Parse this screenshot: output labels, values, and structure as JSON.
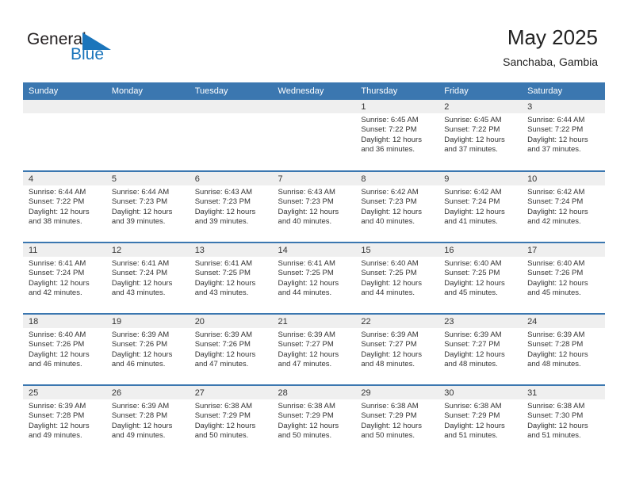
{
  "brand": {
    "name_part1": "General",
    "name_part2": "Blue",
    "flag_icon": "blue-flag-triangle-icon",
    "accent_color": "#1b75bb"
  },
  "header": {
    "title": "May 2025",
    "subtitle": "Sanchaba, Gambia"
  },
  "colors": {
    "header_row_bg": "#3b77b0",
    "daynum_band_bg": "#efefef",
    "row_divider": "#3b77b0",
    "text": "#333333"
  },
  "weekday_headers": [
    "Sunday",
    "Monday",
    "Tuesday",
    "Wednesday",
    "Thursday",
    "Friday",
    "Saturday"
  ],
  "labels": {
    "sunrise_prefix": "Sunrise:",
    "sunset_prefix": "Sunset:",
    "daylight_prefix": "Daylight:"
  },
  "weeks": [
    [
      {
        "day": "",
        "sunrise": "",
        "sunset": "",
        "daylight_line1": "",
        "daylight_line2": "",
        "empty": true
      },
      {
        "day": "",
        "sunrise": "",
        "sunset": "",
        "daylight_line1": "",
        "daylight_line2": "",
        "empty": true
      },
      {
        "day": "",
        "sunrise": "",
        "sunset": "",
        "daylight_line1": "",
        "daylight_line2": "",
        "empty": true
      },
      {
        "day": "",
        "sunrise": "",
        "sunset": "",
        "daylight_line1": "",
        "daylight_line2": "",
        "empty": true
      },
      {
        "day": "1",
        "sunrise": "Sunrise: 6:45 AM",
        "sunset": "Sunset: 7:22 PM",
        "daylight_line1": "Daylight: 12 hours",
        "daylight_line2": "and 36 minutes.",
        "empty": false
      },
      {
        "day": "2",
        "sunrise": "Sunrise: 6:45 AM",
        "sunset": "Sunset: 7:22 PM",
        "daylight_line1": "Daylight: 12 hours",
        "daylight_line2": "and 37 minutes.",
        "empty": false
      },
      {
        "day": "3",
        "sunrise": "Sunrise: 6:44 AM",
        "sunset": "Sunset: 7:22 PM",
        "daylight_line1": "Daylight: 12 hours",
        "daylight_line2": "and 37 minutes.",
        "empty": false
      }
    ],
    [
      {
        "day": "4",
        "sunrise": "Sunrise: 6:44 AM",
        "sunset": "Sunset: 7:22 PM",
        "daylight_line1": "Daylight: 12 hours",
        "daylight_line2": "and 38 minutes.",
        "empty": false
      },
      {
        "day": "5",
        "sunrise": "Sunrise: 6:44 AM",
        "sunset": "Sunset: 7:23 PM",
        "daylight_line1": "Daylight: 12 hours",
        "daylight_line2": "and 39 minutes.",
        "empty": false
      },
      {
        "day": "6",
        "sunrise": "Sunrise: 6:43 AM",
        "sunset": "Sunset: 7:23 PM",
        "daylight_line1": "Daylight: 12 hours",
        "daylight_line2": "and 39 minutes.",
        "empty": false
      },
      {
        "day": "7",
        "sunrise": "Sunrise: 6:43 AM",
        "sunset": "Sunset: 7:23 PM",
        "daylight_line1": "Daylight: 12 hours",
        "daylight_line2": "and 40 minutes.",
        "empty": false
      },
      {
        "day": "8",
        "sunrise": "Sunrise: 6:42 AM",
        "sunset": "Sunset: 7:23 PM",
        "daylight_line1": "Daylight: 12 hours",
        "daylight_line2": "and 40 minutes.",
        "empty": false
      },
      {
        "day": "9",
        "sunrise": "Sunrise: 6:42 AM",
        "sunset": "Sunset: 7:24 PM",
        "daylight_line1": "Daylight: 12 hours",
        "daylight_line2": "and 41 minutes.",
        "empty": false
      },
      {
        "day": "10",
        "sunrise": "Sunrise: 6:42 AM",
        "sunset": "Sunset: 7:24 PM",
        "daylight_line1": "Daylight: 12 hours",
        "daylight_line2": "and 42 minutes.",
        "empty": false
      }
    ],
    [
      {
        "day": "11",
        "sunrise": "Sunrise: 6:41 AM",
        "sunset": "Sunset: 7:24 PM",
        "daylight_line1": "Daylight: 12 hours",
        "daylight_line2": "and 42 minutes.",
        "empty": false
      },
      {
        "day": "12",
        "sunrise": "Sunrise: 6:41 AM",
        "sunset": "Sunset: 7:24 PM",
        "daylight_line1": "Daylight: 12 hours",
        "daylight_line2": "and 43 minutes.",
        "empty": false
      },
      {
        "day": "13",
        "sunrise": "Sunrise: 6:41 AM",
        "sunset": "Sunset: 7:25 PM",
        "daylight_line1": "Daylight: 12 hours",
        "daylight_line2": "and 43 minutes.",
        "empty": false
      },
      {
        "day": "14",
        "sunrise": "Sunrise: 6:41 AM",
        "sunset": "Sunset: 7:25 PM",
        "daylight_line1": "Daylight: 12 hours",
        "daylight_line2": "and 44 minutes.",
        "empty": false
      },
      {
        "day": "15",
        "sunrise": "Sunrise: 6:40 AM",
        "sunset": "Sunset: 7:25 PM",
        "daylight_line1": "Daylight: 12 hours",
        "daylight_line2": "and 44 minutes.",
        "empty": false
      },
      {
        "day": "16",
        "sunrise": "Sunrise: 6:40 AM",
        "sunset": "Sunset: 7:25 PM",
        "daylight_line1": "Daylight: 12 hours",
        "daylight_line2": "and 45 minutes.",
        "empty": false
      },
      {
        "day": "17",
        "sunrise": "Sunrise: 6:40 AM",
        "sunset": "Sunset: 7:26 PM",
        "daylight_line1": "Daylight: 12 hours",
        "daylight_line2": "and 45 minutes.",
        "empty": false
      }
    ],
    [
      {
        "day": "18",
        "sunrise": "Sunrise: 6:40 AM",
        "sunset": "Sunset: 7:26 PM",
        "daylight_line1": "Daylight: 12 hours",
        "daylight_line2": "and 46 minutes.",
        "empty": false
      },
      {
        "day": "19",
        "sunrise": "Sunrise: 6:39 AM",
        "sunset": "Sunset: 7:26 PM",
        "daylight_line1": "Daylight: 12 hours",
        "daylight_line2": "and 46 minutes.",
        "empty": false
      },
      {
        "day": "20",
        "sunrise": "Sunrise: 6:39 AM",
        "sunset": "Sunset: 7:26 PM",
        "daylight_line1": "Daylight: 12 hours",
        "daylight_line2": "and 47 minutes.",
        "empty": false
      },
      {
        "day": "21",
        "sunrise": "Sunrise: 6:39 AM",
        "sunset": "Sunset: 7:27 PM",
        "daylight_line1": "Daylight: 12 hours",
        "daylight_line2": "and 47 minutes.",
        "empty": false
      },
      {
        "day": "22",
        "sunrise": "Sunrise: 6:39 AM",
        "sunset": "Sunset: 7:27 PM",
        "daylight_line1": "Daylight: 12 hours",
        "daylight_line2": "and 48 minutes.",
        "empty": false
      },
      {
        "day": "23",
        "sunrise": "Sunrise: 6:39 AM",
        "sunset": "Sunset: 7:27 PM",
        "daylight_line1": "Daylight: 12 hours",
        "daylight_line2": "and 48 minutes.",
        "empty": false
      },
      {
        "day": "24",
        "sunrise": "Sunrise: 6:39 AM",
        "sunset": "Sunset: 7:28 PM",
        "daylight_line1": "Daylight: 12 hours",
        "daylight_line2": "and 48 minutes.",
        "empty": false
      }
    ],
    [
      {
        "day": "25",
        "sunrise": "Sunrise: 6:39 AM",
        "sunset": "Sunset: 7:28 PM",
        "daylight_line1": "Daylight: 12 hours",
        "daylight_line2": "and 49 minutes.",
        "empty": false
      },
      {
        "day": "26",
        "sunrise": "Sunrise: 6:39 AM",
        "sunset": "Sunset: 7:28 PM",
        "daylight_line1": "Daylight: 12 hours",
        "daylight_line2": "and 49 minutes.",
        "empty": false
      },
      {
        "day": "27",
        "sunrise": "Sunrise: 6:38 AM",
        "sunset": "Sunset: 7:29 PM",
        "daylight_line1": "Daylight: 12 hours",
        "daylight_line2": "and 50 minutes.",
        "empty": false
      },
      {
        "day": "28",
        "sunrise": "Sunrise: 6:38 AM",
        "sunset": "Sunset: 7:29 PM",
        "daylight_line1": "Daylight: 12 hours",
        "daylight_line2": "and 50 minutes.",
        "empty": false
      },
      {
        "day": "29",
        "sunrise": "Sunrise: 6:38 AM",
        "sunset": "Sunset: 7:29 PM",
        "daylight_line1": "Daylight: 12 hours",
        "daylight_line2": "and 50 minutes.",
        "empty": false
      },
      {
        "day": "30",
        "sunrise": "Sunrise: 6:38 AM",
        "sunset": "Sunset: 7:29 PM",
        "daylight_line1": "Daylight: 12 hours",
        "daylight_line2": "and 51 minutes.",
        "empty": false
      },
      {
        "day": "31",
        "sunrise": "Sunrise: 6:38 AM",
        "sunset": "Sunset: 7:30 PM",
        "daylight_line1": "Daylight: 12 hours",
        "daylight_line2": "and 51 minutes.",
        "empty": false
      }
    ]
  ]
}
